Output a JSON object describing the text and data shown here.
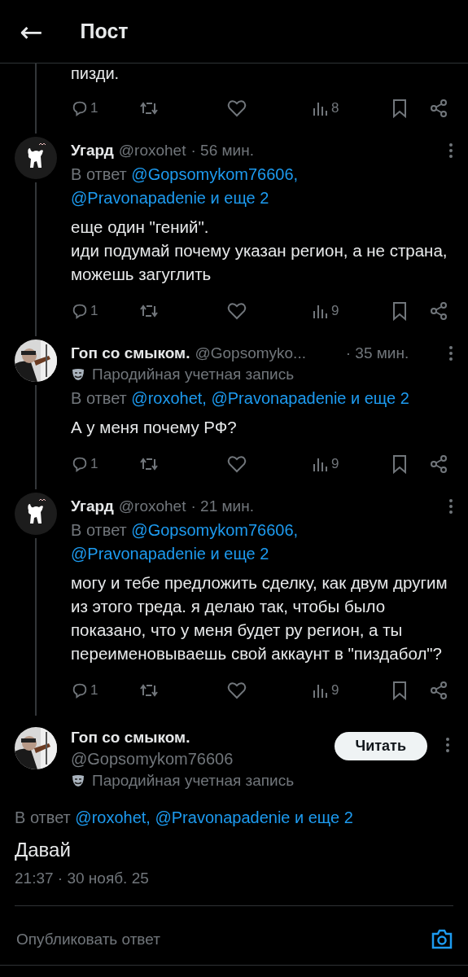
{
  "header": {
    "back": "←",
    "title": "Пост"
  },
  "previous": {
    "text": "пизди.",
    "replies": "1",
    "views": "8"
  },
  "replies": [
    {
      "kind": "reply",
      "avatar": {
        "kind": "drawing"
      },
      "name": "Угард",
      "handle": "@roxohet",
      "time": "· 56 мин.",
      "reply_prefix": "В ответ",
      "reply_mentions": [
        "@Gopsomykom76606,",
        "@Pravonapadenie и еще 2"
      ],
      "text": "еще один \"гений\".\nиди подумай почему указан регион, а не страна, можешь загуглить",
      "replies": "1",
      "views": "9"
    },
    {
      "kind": "reply",
      "avatar": {
        "kind": "picture"
      },
      "name": "Гоп со смыком.",
      "handle": "@Gopsomyko...",
      "time": "· 35 мин.",
      "parody": "Пародийная учетная запись",
      "reply_prefix": "В ответ",
      "reply_mentions": [
        "@roxohet,",
        "@Pravonapadenie и еще 2"
      ],
      "text": "А у меня почему РФ?",
      "replies": "1",
      "views": "9"
    },
    {
      "kind": "reply",
      "avatar": {
        "kind": "drawing"
      },
      "name": "Угард",
      "handle": "@roxohet",
      "time": "· 21 мин.",
      "reply_prefix": "В ответ",
      "reply_mentions": [
        "@Gopsomykom76606,",
        "@Pravonapadenie и еще 2"
      ],
      "text": "могу и тебе предложить сделку, как двум другим из этого треда. я делаю так, чтобы было показано, что у меня будет ру регион, а ты переименовываешь свой аккаунт в \"пиздабол\"?",
      "replies": "1",
      "views": "9"
    }
  ],
  "main": {
    "avatar": {
      "kind": "picture"
    },
    "name": "Гоп со смыком.",
    "handle": "@Gopsomykom76606",
    "parody": "Пародийная учетная запись",
    "follow": "Читать",
    "reply_prefix": "В ответ",
    "reply_mentions": [
      "@roxohet,",
      "@Pravonapadenie и еще 2"
    ],
    "text": "Давай",
    "timestamp": "21:37 · 30 нояб. 25"
  },
  "composer": {
    "placeholder": "Опубликовать ответ"
  }
}
